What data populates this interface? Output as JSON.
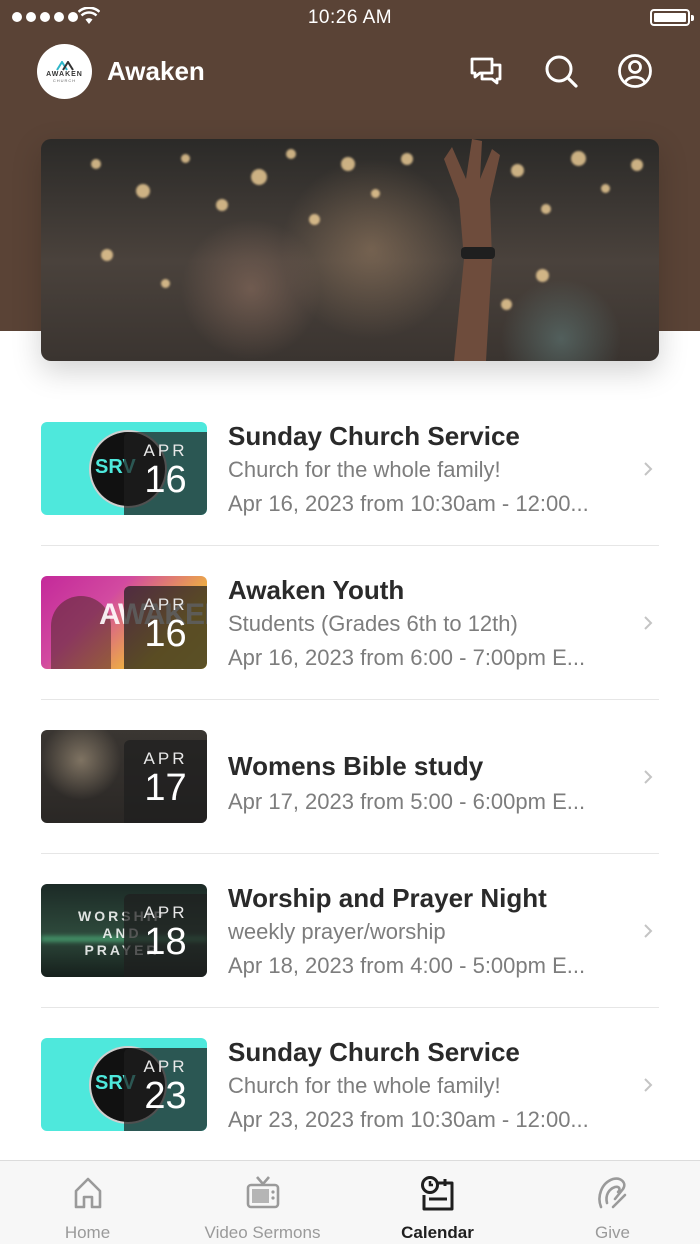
{
  "status_bar": {
    "time": "10:26 AM"
  },
  "header": {
    "logo_text": "AWAKEN",
    "logo_subtext": "CHURCH",
    "title": "Awaken",
    "icons": [
      "chat-icon",
      "search-icon",
      "profile-icon"
    ]
  },
  "events": [
    {
      "title": "Sunday Church Service",
      "subtitle": "Church for the whole family!",
      "datetime": "Apr 16, 2023 from 10:30am - 12:00...",
      "month": "APR",
      "day": "16",
      "thumb_text": "SRV"
    },
    {
      "title": "Awaken Youth",
      "subtitle": "Students (Grades 6th to 12th)",
      "datetime": "Apr 16, 2023 from 6:00 - 7:00pm E...",
      "month": "APR",
      "day": "16",
      "thumb_text": "AWAKEN"
    },
    {
      "title": "Womens Bible study",
      "subtitle": "",
      "datetime": "Apr 17, 2023 from 5:00 - 6:00pm E...",
      "month": "APR",
      "day": "17",
      "thumb_text": ""
    },
    {
      "title": "Worship and Prayer Night",
      "subtitle": "weekly prayer/worship",
      "datetime": "Apr 18, 2023 from 4:00 - 5:00pm E...",
      "month": "APR",
      "day": "18",
      "thumb_text": "WORSHIP AND PRAYER"
    },
    {
      "title": "Sunday Church Service",
      "subtitle": "Church for the whole family!",
      "datetime": "Apr 23, 2023 from 10:30am - 12:00...",
      "month": "APR",
      "day": "23",
      "thumb_text": "SRV"
    }
  ],
  "tabs": [
    {
      "label": "Home",
      "icon": "home-icon",
      "active": false
    },
    {
      "label": "Video Sermons",
      "icon": "tv-icon",
      "active": false
    },
    {
      "label": "Calendar",
      "icon": "calendar-icon",
      "active": true
    },
    {
      "label": "Give",
      "icon": "give-icon",
      "active": false
    }
  ],
  "colors": {
    "header_bg": "#5a4336",
    "accent_cyan": "#4ee8dc",
    "text_dark": "#2a2a2a",
    "text_muted": "#7d7d7d"
  }
}
